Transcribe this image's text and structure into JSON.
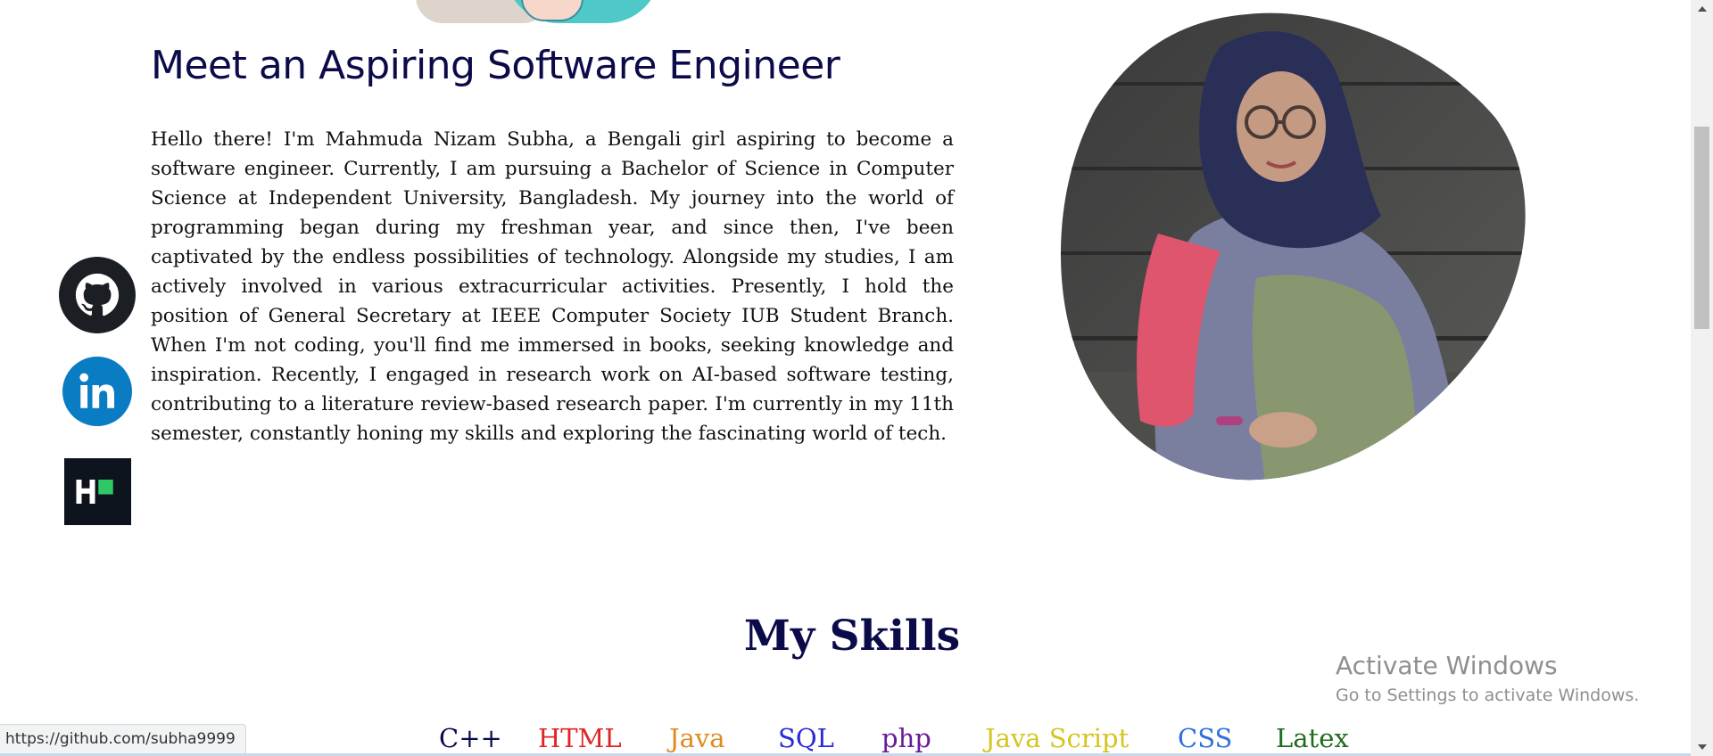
{
  "about": {
    "title": "Meet an Aspiring Software Engineer",
    "text": "Hello there! I'm Mahmuda Nizam Subha, a Bengali girl aspiring to become a software engineer. Currently, I am pursuing a Bachelor of Science in Computer Science at Independent University, Bangladesh. My journey into the world of programming began during my freshman year, and since then, I've been captivated by the endless possibilities of technology. Alongside my studies, I am actively involved in various extracurricular activities. Presently, I hold the position of General Secretary at IEEE Computer Society IUB Student Branch. When I'm not coding, you'll find me immersed in books, seeking knowledge and inspiration. Recently, I engaged in research work on AI-based software testing, contributing to a literature review-based research paper. I'm currently in my 11th semester, constantly honing my skills and exploring the fascinating world of tech."
  },
  "social_links": [
    {
      "name": "GitHub",
      "icon": "github-icon"
    },
    {
      "name": "LinkedIn",
      "icon": "linkedin-icon"
    },
    {
      "name": "HackerRank",
      "icon": "hackerrank-icon"
    }
  ],
  "skills": {
    "title": "My Skills",
    "items": [
      {
        "label": "C++",
        "color": "#0b0b4a"
      },
      {
        "label": "HTML",
        "color": "#e02424"
      },
      {
        "label": "Java",
        "color": "#e08a1e"
      },
      {
        "label": "SQL",
        "color": "#2a2ad8"
      },
      {
        "label": "php",
        "color": "#6a1b9a"
      },
      {
        "label": "Java Script",
        "color": "#d4c520"
      },
      {
        "label": "CSS",
        "color": "#2f6fe0"
      },
      {
        "label": "Latex",
        "color": "#1f6b1f"
      }
    ]
  },
  "watermark": {
    "title": "Activate Windows",
    "subtitle": "Go to Settings to activate Windows."
  },
  "status_bar": {
    "url": "https://github.com/subha9999"
  },
  "colors": {
    "heading": "#0b0b4a",
    "linkedin": "#0a7cc4",
    "hackerrank_bg": "#0e141e",
    "hackerrank_accent": "#2ec866"
  }
}
